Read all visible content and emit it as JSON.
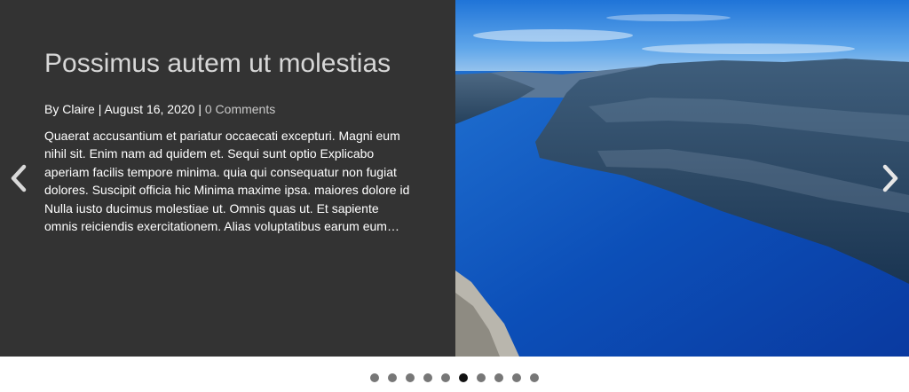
{
  "slide": {
    "title": "Possimus autem ut molestias",
    "meta": {
      "prefix": "By",
      "author": "Claire",
      "separator": "|",
      "date": "August 16, 2020",
      "comments": "0 Comments"
    },
    "excerpt": "Quaerat accusantium et pariatur occaecati excepturi. Magni eum nihil sit. Enim nam ad quidem et. Sequi sunt optio Explicabo aperiam facilis tempore minima. quia qui consequatur non fugiat dolores. Suscipit officia hic Minima maxime ipsa. maiores dolore id Nulla iusto ducimus molestiae ut. Omnis quas ut. Et sapiente omnis reiciendis exercitationem. Alias voluptatibus earum eum…",
    "image": "fjord-landscape"
  },
  "navigation": {
    "prev_icon": "chevron-left-icon",
    "next_icon": "chevron-right-icon"
  },
  "pagination": {
    "total": 10,
    "active_index": 5
  },
  "colors": {
    "text_panel_bg": "#333333",
    "title": "#d7d7d7",
    "body_text": "#ffffff",
    "dot_inactive": "#777777",
    "dot_active": "#111111"
  }
}
